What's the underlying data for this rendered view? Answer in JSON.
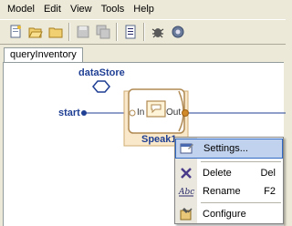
{
  "menubar": {
    "items": [
      "Model",
      "Edit",
      "View",
      "Tools",
      "Help"
    ]
  },
  "toolbar": {
    "buttons": [
      "new-icon",
      "open-icon",
      "folder-icon",
      "save-icon",
      "save-all-icon",
      "properties-icon",
      "debug-icon",
      "run-icon"
    ]
  },
  "tabs": [
    {
      "label": "queryInventory",
      "active": true
    }
  ],
  "diagram": {
    "datastore_label": "dataStore",
    "start_label": "start",
    "node_label": "Speak1",
    "port_in": "In",
    "port_out": "Out"
  },
  "context_menu": {
    "items": [
      {
        "label": "Settings...",
        "shortcut": "",
        "icon": "settings-icon",
        "highlighted": true
      },
      {
        "label": "Delete",
        "shortcut": "Del",
        "icon": "delete-icon"
      },
      {
        "label": "Rename",
        "shortcut": "F2",
        "icon": "rename-icon"
      },
      {
        "label": "Configure",
        "shortcut": "",
        "icon": "configure-icon"
      }
    ]
  },
  "colors": {
    "accent": "#1f3f94",
    "highlight": "#c1d2ee",
    "node_border": "#b08a52"
  }
}
